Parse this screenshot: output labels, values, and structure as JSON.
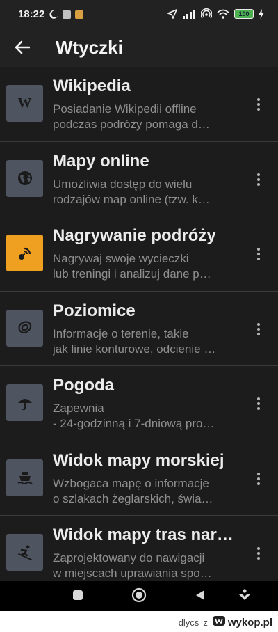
{
  "status_bar": {
    "time": "18:22",
    "battery": "100"
  },
  "app_bar": {
    "title": "Wtyczki"
  },
  "plugins": [
    {
      "title": "Wikipedia",
      "desc_line1": "Posiadanie Wikipedii offline",
      "desc_line2": "podczas podróży pomaga d…",
      "icon": "wikipedia-icon",
      "icon_glyph": "W",
      "icon_bg": "#4e5560"
    },
    {
      "title": "Mapy online",
      "desc_line1": "Umożliwia dostęp do wielu",
      "desc_line2": "rodzajów map online (tzw. k…",
      "icon": "globe-icon",
      "icon_bg": "#4e5560"
    },
    {
      "title": "Nagrywanie podróży",
      "desc_line1": "Nagrywaj swoje wycieczki",
      "desc_line2": "lub treningi i analizuj dane p…",
      "icon": "trip-recording-icon",
      "icon_bg": "#f0a020"
    },
    {
      "title": "Poziomice",
      "desc_line1": "Informacje o terenie, takie",
      "desc_line2": "jak linie konturowe, odcienie …",
      "icon": "contour-lines-icon",
      "icon_bg": "#4e5560"
    },
    {
      "title": "Pogoda",
      "desc_line1": "Zapewnia",
      "desc_line2": "- 24-godzinną i 7-dniową pro…",
      "icon": "umbrella-icon",
      "icon_bg": "#4e5560"
    },
    {
      "title": "Widok mapy morskiej",
      "desc_line1": "Wzbogaca mapę o informacje",
      "desc_line2": "o szlakach żeglarskich, świa…",
      "icon": "ship-icon",
      "icon_bg": "#4e5560"
    },
    {
      "title": "Widok mapy tras nar…",
      "desc_line1": "Zaprojektowany do nawigacji",
      "desc_line2": "w miejscach uprawiania spo…",
      "icon": "skier-icon",
      "icon_bg": "#4e5560"
    }
  ],
  "watermark": {
    "user": "dlycs",
    "z": "z",
    "site": "wykop.pl"
  },
  "colors": {
    "background": "#1c1c1c",
    "bar": "#222222",
    "accent_orange": "#f0a020",
    "icon_tile": "#4e5560"
  }
}
